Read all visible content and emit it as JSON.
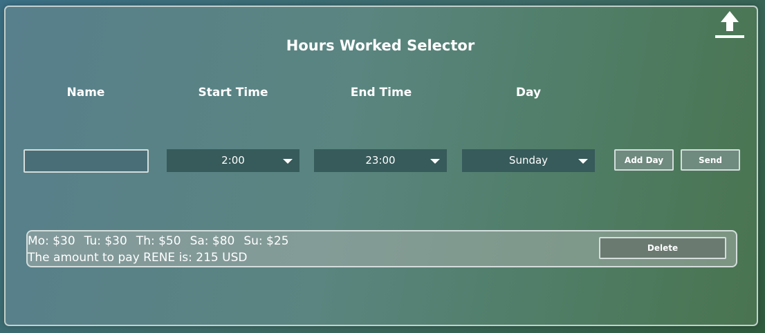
{
  "header": {
    "title": "Hours Worked Selector",
    "upload_icon": "upload-arrow-icon"
  },
  "columns": {
    "name": "Name",
    "start_time": "Start Time",
    "end_time": "End Time",
    "day": "Day"
  },
  "form": {
    "name_value": "",
    "name_placeholder": "",
    "start_time_selected": "2:00",
    "end_time_selected": "23:00",
    "day_selected": "Sunday",
    "add_day_label": "Add Day",
    "send_label": "Send"
  },
  "result": {
    "days": [
      "Mo: $30",
      "Tu: $30",
      "Th: $50",
      "Sa: $80",
      "Su: $25"
    ],
    "summary": "The amount to pay RENE is: 215 USD",
    "delete_label": "Delete"
  },
  "colors": {
    "panel_border": "#d4dedc",
    "select_bg": "#375a5a",
    "text": "#ffffff"
  }
}
